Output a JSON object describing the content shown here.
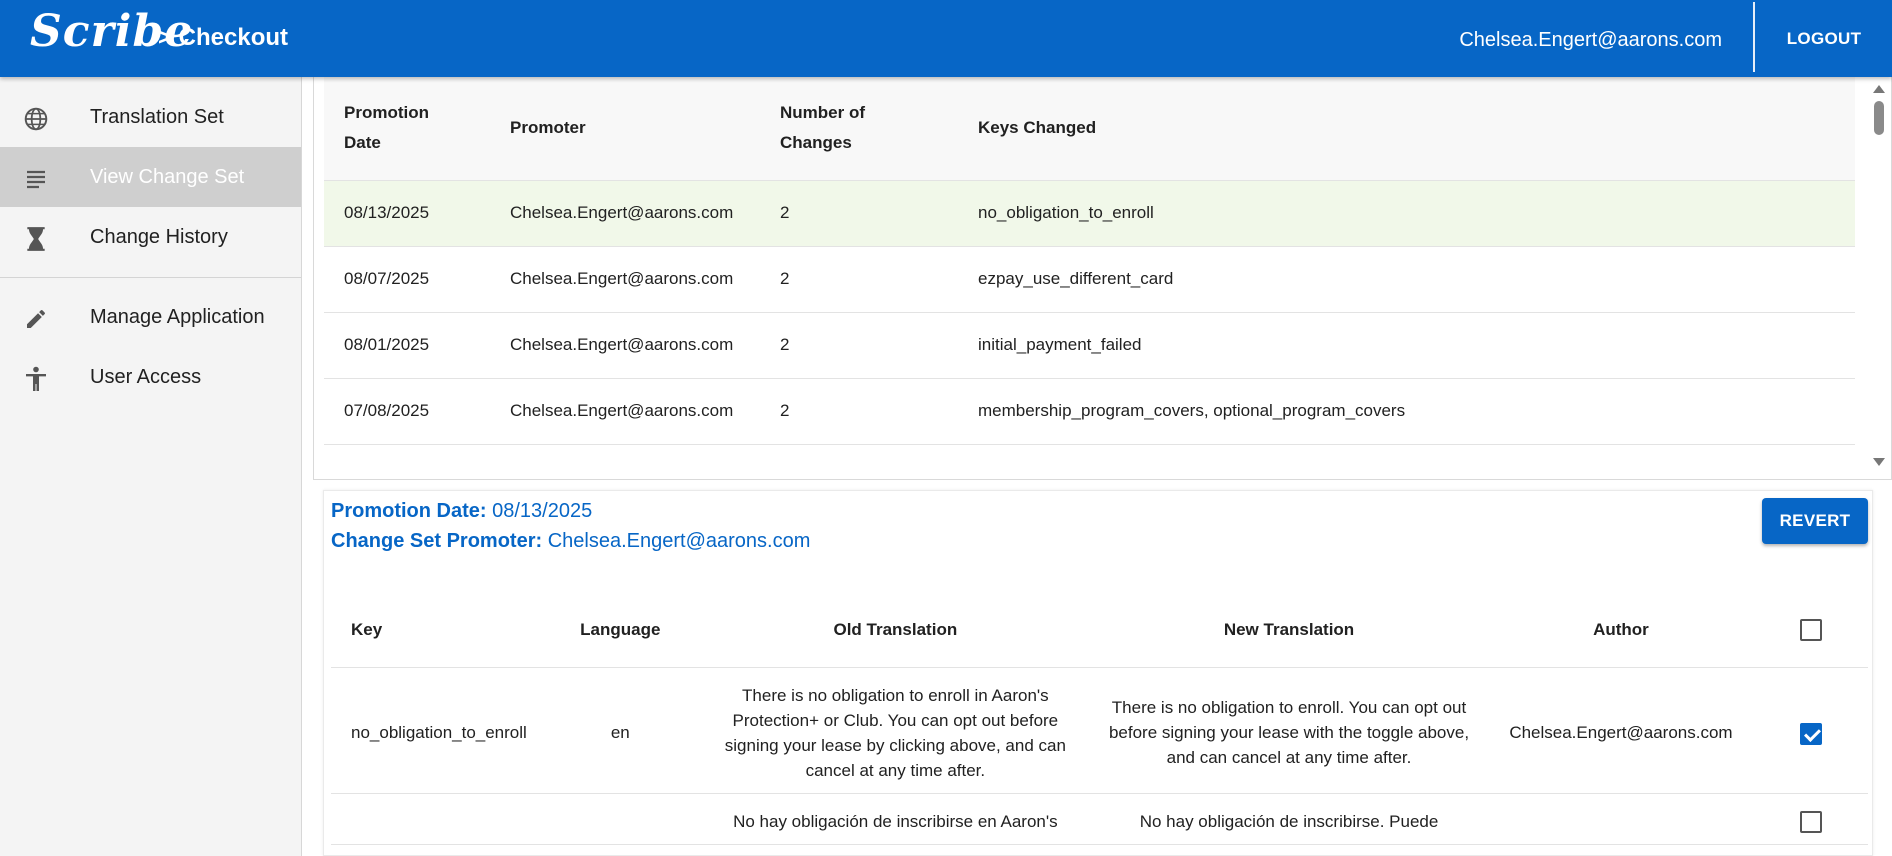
{
  "header": {
    "logo": "Scribe",
    "breadcrumb": "> Checkout",
    "user_email": "Chelsea.Engert@aarons.com",
    "logout_label": "LOGOUT",
    "background_color": "#0766c6"
  },
  "sidebar": {
    "items": [
      {
        "label": "Translation Set",
        "icon": "globe-icon",
        "active": false
      },
      {
        "label": "View Change Set",
        "icon": "list-lines-icon",
        "active": true
      },
      {
        "label": "Change History",
        "icon": "hourglass-icon",
        "active": false
      },
      {
        "label": "Manage Application",
        "icon": "pencil-icon",
        "active": false
      },
      {
        "label": "User Access",
        "icon": "accessibility-icon",
        "active": false
      }
    ]
  },
  "change_sets": {
    "columns": [
      "Promotion Date",
      "Promoter",
      "Number of Changes",
      "Keys Changed"
    ],
    "rows": [
      {
        "date": "08/13/2025",
        "promoter": "Chelsea.Engert@aarons.com",
        "changes": "2",
        "keys": "no_obligation_to_enroll",
        "selected": true
      },
      {
        "date": "08/07/2025",
        "promoter": "Chelsea.Engert@aarons.com",
        "changes": "2",
        "keys": "ezpay_use_different_card",
        "selected": false
      },
      {
        "date": "08/01/2025",
        "promoter": "Chelsea.Engert@aarons.com",
        "changes": "2",
        "keys": "initial_payment_failed",
        "selected": false
      },
      {
        "date": "07/08/2025",
        "promoter": "Chelsea.Engert@aarons.com",
        "changes": "2",
        "keys": "membership_program_covers, optional_program_covers",
        "selected": false
      }
    ]
  },
  "details": {
    "promotion_date_label": "Promotion Date:",
    "promotion_date_value": "08/13/2025",
    "promoter_label": "Change Set Promoter:",
    "promoter_value": "Chelsea.Engert@aarons.com",
    "revert_label": "REVERT",
    "columns": [
      "Key",
      "Language",
      "Old Translation",
      "New Translation",
      "Author"
    ],
    "header_checkbox_checked": false,
    "rows": [
      {
        "key": "no_obligation_to_enroll",
        "language": "en",
        "old": "There is no obligation to enroll in Aaron's Protection+ or Club. You can opt out before signing your lease by clicking above, and can cancel at any time after.",
        "new": "There is no obligation to enroll. You can opt out before signing your lease with the toggle above, and can cancel at any time after.",
        "author": "Chelsea.Engert@aarons.com",
        "checked": true
      },
      {
        "key": "",
        "language": "",
        "old": "No hay obligación de inscribirse en Aaron's",
        "new": "No hay obligación de inscribirse. Puede",
        "author": "",
        "checked": false
      }
    ]
  }
}
